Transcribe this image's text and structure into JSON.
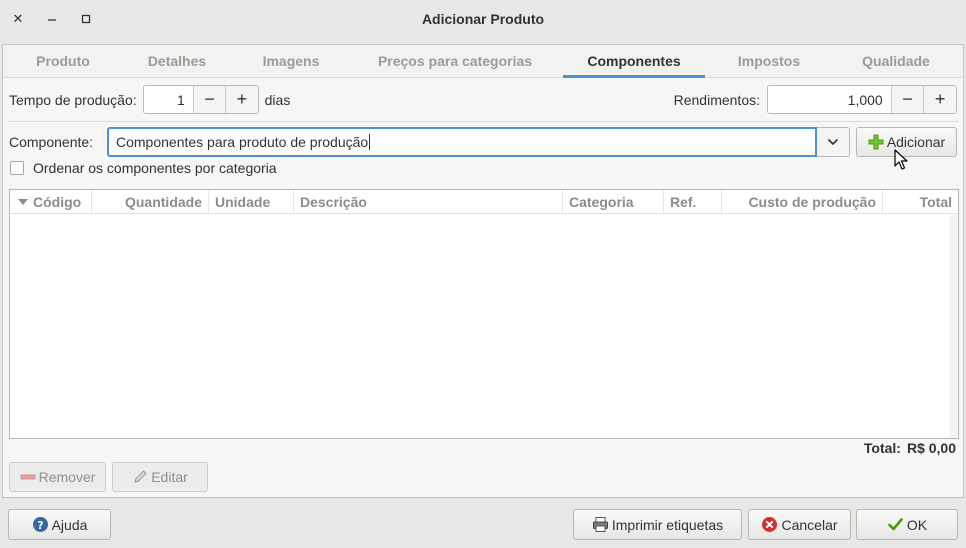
{
  "window": {
    "title": "Adicionar Produto",
    "controls": [
      "close",
      "minimize",
      "maximize"
    ]
  },
  "tabs": [
    {
      "label": "Produto",
      "active": false
    },
    {
      "label": "Detalhes",
      "active": false
    },
    {
      "label": "Imagens",
      "active": false
    },
    {
      "label": "Preços para categorias",
      "active": false
    },
    {
      "label": "Componentes",
      "active": true
    },
    {
      "label": "Impostos",
      "active": false
    },
    {
      "label": "Qualidade",
      "active": false
    }
  ],
  "production": {
    "time_label": "Tempo de produção:",
    "time_value": "1",
    "time_unit": "dias",
    "yield_label": "Rendimentos:",
    "yield_value": "1,000",
    "minus": "−",
    "plus": "+"
  },
  "component": {
    "label": "Componente:",
    "value": "Componentes para produto de produção",
    "add_label": "Adicionar",
    "sort_label": "Ordenar os componentes por categoria",
    "sort_checked": false
  },
  "table": {
    "columns": [
      "Código",
      "Quantidade",
      "Unidade",
      "Descrição",
      "Categoria",
      "Ref.",
      "Custo de produção",
      "Total"
    ],
    "rows": []
  },
  "total": {
    "label": "Total:",
    "value": "R$ 0,00"
  },
  "actions": {
    "remove_label": "Remover",
    "edit_label": "Editar"
  },
  "footer": {
    "help_label": "Ajuda",
    "print_label": "Imprimir etiquetas",
    "cancel_label": "Cancelar",
    "ok_label": "OK"
  },
  "colors": {
    "accent": "#4a90d9",
    "add_icon": "#73c23a",
    "cancel_icon": "#d52f2f",
    "ok_icon": "#4e9a06",
    "remove_icon": "#e57373",
    "help_icon": "#3465a4"
  }
}
